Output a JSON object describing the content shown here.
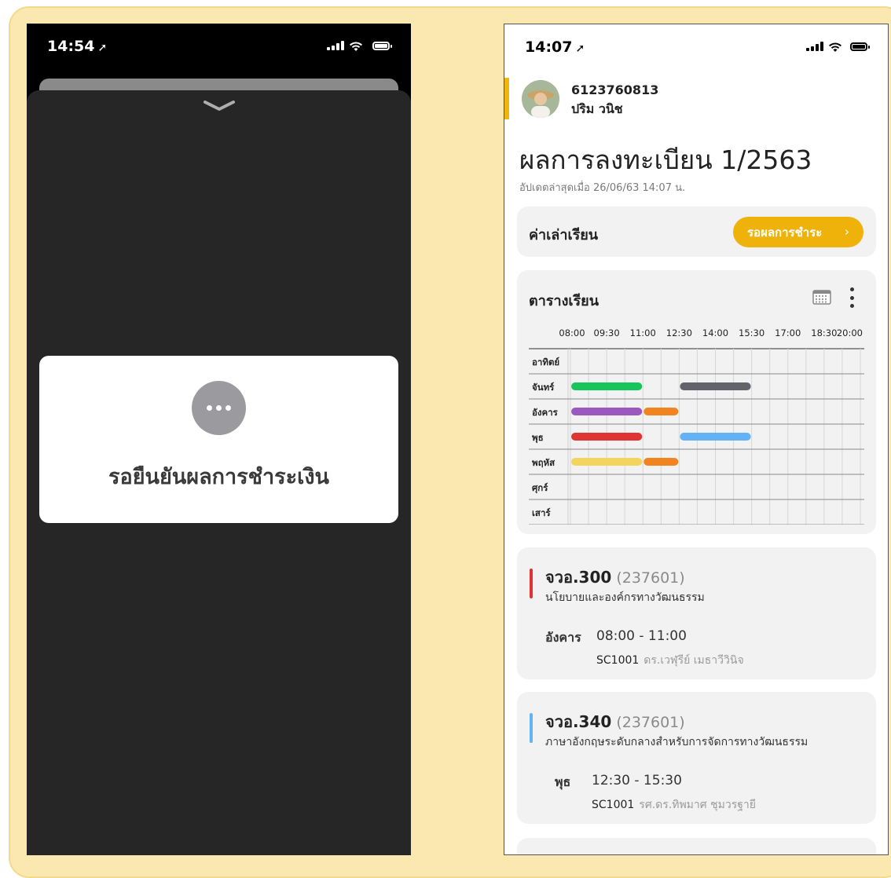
{
  "left_screen": {
    "time": "14:54",
    "dialog_message": "รอยืนยันผลการชำระเงิน"
  },
  "right_screen": {
    "time": "14:07",
    "user": {
      "student_id": "6123760813",
      "name": "ปริม วนิช"
    },
    "page_title": "ผลการลงทะเบียน 1/2563",
    "updated": "อัปเดตล่าสุดเมื่อ 26/06/63 14:07 น.",
    "tuition": {
      "label": "ค่าเล่าเรียน",
      "status_button": "รอผลการชำระ",
      "chevron": "›"
    },
    "schedule": {
      "title": "ตารางเรียน",
      "time_ticks": [
        "08:00",
        "09:30",
        "11:00",
        "12:30",
        "14:00",
        "15:30",
        "17:00",
        "18:30",
        "20:00"
      ],
      "days": [
        "อาทิตย์",
        "จันทร์",
        "อังคาร",
        "พุธ",
        "พฤหัส",
        "ศุกร์",
        "เสาร์"
      ],
      "blocks": [
        {
          "day": 1,
          "start": "08:00",
          "end": "11:00",
          "color": "#17c55a"
        },
        {
          "day": 1,
          "start": "12:30",
          "end": "15:30",
          "color": "#63646b"
        },
        {
          "day": 2,
          "start": "08:00",
          "end": "11:00",
          "color": "#9b59c0"
        },
        {
          "day": 2,
          "start": "11:00",
          "end": "12:30",
          "color": "#ef8421"
        },
        {
          "day": 3,
          "start": "08:00",
          "end": "11:00",
          "color": "#e03434"
        },
        {
          "day": 3,
          "start": "12:30",
          "end": "15:30",
          "color": "#62b2f5"
        },
        {
          "day": 4,
          "start": "08:00",
          "end": "11:00",
          "color": "#f3d45c"
        },
        {
          "day": 4,
          "start": "11:00",
          "end": "12:30",
          "color": "#ef8421"
        }
      ]
    },
    "courses": [
      {
        "code": "จวอ.300",
        "section": "(237601)",
        "name": "นโยบายและองค์กรทางวัฒนธรรม",
        "day": "อังคาร",
        "time": "08:00  -  11:00",
        "room": "SC1001",
        "teacher": "ดร.เวฬุรีย์ เมธาวีวินิจ",
        "color": "#e03434"
      },
      {
        "code": "จวอ.340",
        "section": "(237601)",
        "name": "ภาษาอังกฤษระดับกลางสำหรับการจัดการทางวัฒนธรรม",
        "day": "พุธ",
        "time": "12:30  -  15:30",
        "room": "SC1001",
        "teacher": "รศ.ดร.ทิพมาศ ชุมวรฐายี",
        "color": "#62b2f5"
      }
    ]
  }
}
